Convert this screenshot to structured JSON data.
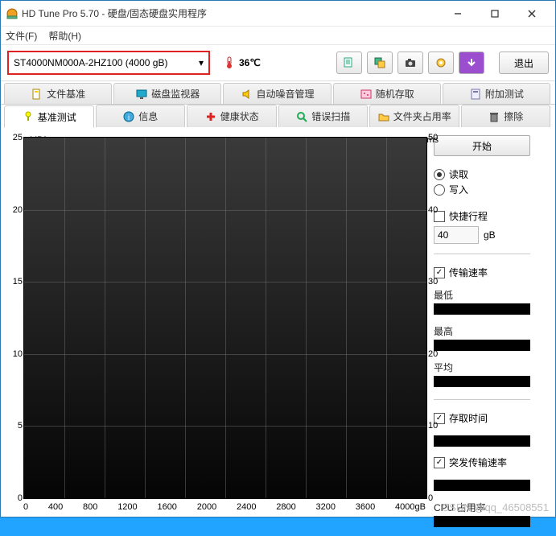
{
  "window": {
    "title": "HD Tune Pro 5.70 - 硬盘/固态硬盘实用程序"
  },
  "menubar": {
    "file": "文件(F)",
    "help": "帮助(H)"
  },
  "toolbar": {
    "drive_selected": "ST4000NM000A-2HZ100 (4000 gB)",
    "temperature": "36℃",
    "exit_label": "退出"
  },
  "tabs_top": [
    "文件基准",
    "磁盘监视器",
    "自动噪音管理",
    "随机存取",
    "附加测试"
  ],
  "tabs_bottom": [
    "基准测试",
    "信息",
    "健康状态",
    "错误扫描",
    "文件夹占用率",
    "擦除"
  ],
  "chart_data": {
    "type": "line",
    "title": "",
    "xlabel": "gB",
    "ylabel_left": "MB/s",
    "ylabel_right": "ms",
    "y_left_ticks": [
      0,
      5,
      10,
      15,
      20,
      25
    ],
    "y_right_ticks": [
      0,
      10,
      20,
      30,
      40,
      50
    ],
    "x_ticks": [
      0,
      400,
      800,
      1200,
      1600,
      2000,
      2400,
      2800,
      3200,
      3600,
      4000
    ],
    "x_unit_label": "4000gB",
    "series": []
  },
  "side": {
    "start_label": "开始",
    "radio_read": "读取",
    "radio_write": "写入",
    "short_stroke_label": "快捷行程",
    "short_stroke_value": "40",
    "short_stroke_unit": "gB",
    "transfer_rate_label": "传输速率",
    "min_label": "最低",
    "max_label": "最高",
    "avg_label": "平均",
    "access_time_label": "存取时间",
    "burst_rate_label": "突发传输速率",
    "cpu_usage_label": "CPU 占用率"
  },
  "watermark": "CSDN @qq_46508551"
}
